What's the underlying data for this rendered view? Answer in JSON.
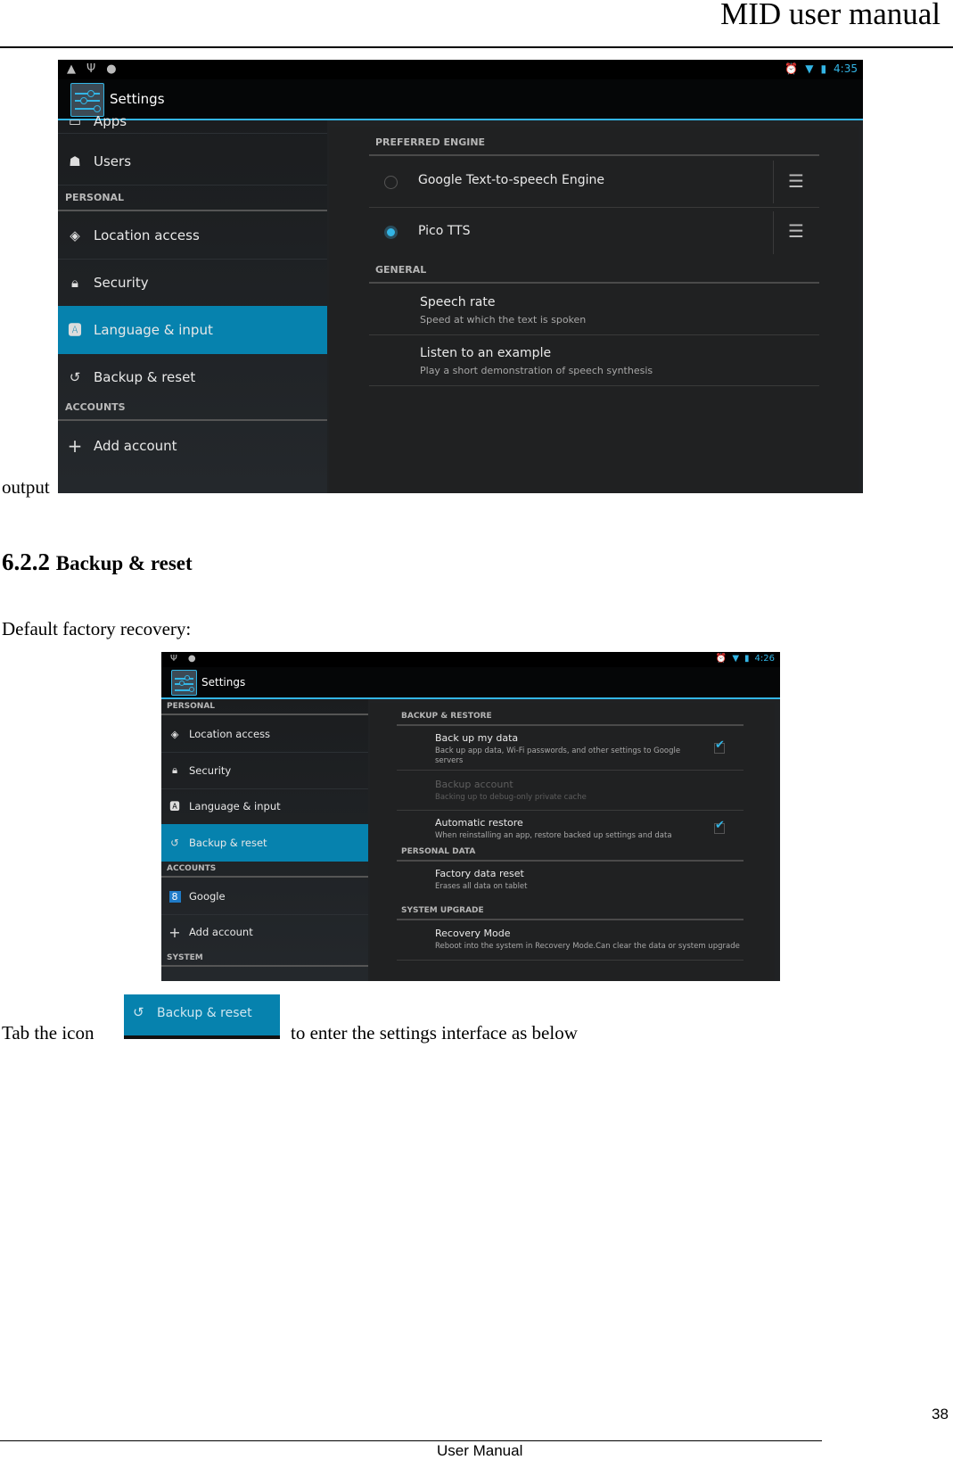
{
  "header": {
    "title": "MID user manual"
  },
  "screenshot1": {
    "status": {
      "left_icons": [
        "warning-icon",
        "usb-icon",
        "android-debug-icon"
      ],
      "right_icons": [
        "alarm-icon",
        "wifi-icon",
        "battery-charging-icon"
      ],
      "time": "4:35"
    },
    "actionbar": {
      "title": "Settings"
    },
    "left": {
      "partial_item": "Apps",
      "items_top": [
        {
          "label": "Users",
          "icon": "users-icon"
        }
      ],
      "personal_header": "PERSONAL",
      "personal_items": [
        {
          "label": "Location access",
          "icon": "location-icon"
        },
        {
          "label": "Security",
          "icon": "lock-icon"
        },
        {
          "label": "Language & input",
          "icon": "language-icon",
          "selected": true
        },
        {
          "label": "Backup & reset",
          "icon": "backup-icon"
        }
      ],
      "accounts_header": "ACCOUNTS",
      "accounts_items": [
        {
          "label": "Add account",
          "icon": "plus-icon"
        }
      ]
    },
    "right": {
      "preferred_header": "PREFERRED ENGINE",
      "engines": [
        {
          "label": "Google Text-to-speech Engine",
          "selected": false
        },
        {
          "label": "Pico TTS",
          "selected": true
        }
      ],
      "general_header": "GENERAL",
      "general_items": [
        {
          "title": "Speech rate",
          "summary": "Speed at which the text is spoken"
        },
        {
          "title": "Listen to an example",
          "summary": "Play a short demonstration of speech synthesis"
        }
      ]
    }
  },
  "caption_left": "output",
  "section": {
    "number": "6.2.2",
    "title": "Backup & reset"
  },
  "intro": "Default factory recovery:",
  "screenshot2": {
    "status": {
      "left_icons": [
        "usb-icon",
        "android-debug-icon"
      ],
      "right_icons": [
        "alarm-icon",
        "wifi-icon",
        "battery-charging-icon"
      ],
      "time": "4:26"
    },
    "actionbar": {
      "title": "Settings"
    },
    "left": {
      "personal_header": "PERSONAL",
      "personal_items": [
        {
          "label": "Location access",
          "icon": "location-icon"
        },
        {
          "label": "Security",
          "icon": "lock-icon"
        },
        {
          "label": "Language & input",
          "icon": "language-icon"
        },
        {
          "label": "Backup & reset",
          "icon": "backup-icon",
          "selected": true
        }
      ],
      "accounts_header": "ACCOUNTS",
      "accounts_items": [
        {
          "label": "Google",
          "icon": "google-icon"
        },
        {
          "label": "Add account",
          "icon": "plus-icon"
        }
      ],
      "system_header": "SYSTEM"
    },
    "right": {
      "backup_header": "BACKUP & RESTORE",
      "backup_items": [
        {
          "title": "Back up my data",
          "summary": "Back up app data, Wi-Fi passwords, and other settings to Google servers",
          "checked": true
        },
        {
          "title": "Backup account",
          "summary": "Backing up to debug-only private cache",
          "disabled": true
        },
        {
          "title": "Automatic restore",
          "summary": "When reinstalling an app, restore backed up settings and data",
          "checked": true
        }
      ],
      "personal_data_header": "PERSONAL DATA",
      "personal_data_items": [
        {
          "title": "Factory data reset",
          "summary": "Erases all data on tablet"
        }
      ],
      "system_upgrade_header": "SYSTEM UPGRADE",
      "system_upgrade_items": [
        {
          "title": "Recovery Mode",
          "summary": "Reboot into the system in Recovery Mode.Can clear the data or system upgrade"
        }
      ]
    }
  },
  "tab_sentence": {
    "before": "Tab the icon",
    "button_label": "Backup & reset",
    "after": "to enter the settings interface as below"
  },
  "footer": {
    "page_number": "38",
    "label": "User Manual"
  }
}
